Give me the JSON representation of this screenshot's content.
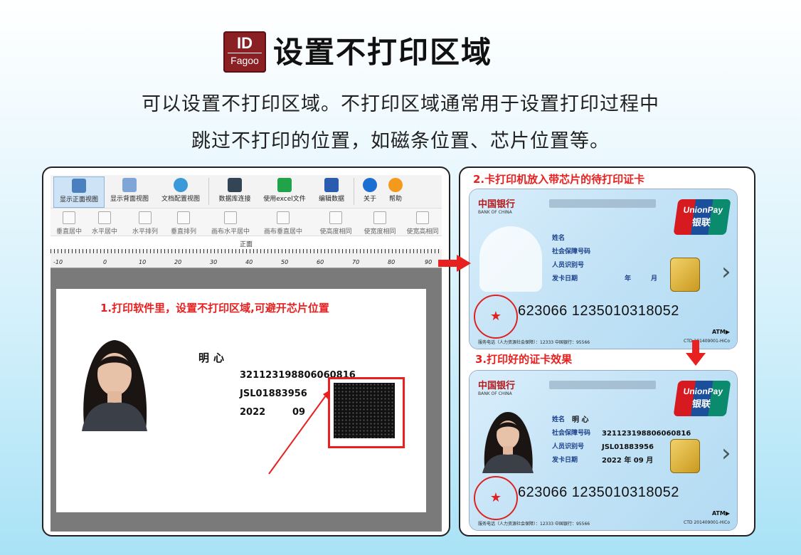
{
  "logo": {
    "line1": "ID",
    "line2": "Fagoo"
  },
  "title": "设置不打印区域",
  "subtitle": {
    "line1": "可以设置不打印区域。不打印区域通常用于设置打印过程中",
    "line2": "跳过不打印的位置，如磁条位置、芯片位置等。"
  },
  "software": {
    "toolbar1": [
      "显示正面视图",
      "显示背面视图",
      "文档配置视图",
      "数据库连接",
      "使用excel文件",
      "编辑数据",
      "关于",
      "帮助"
    ],
    "toolbar2": [
      "垂直居中",
      "水平居中",
      "水平排列",
      "垂直排列",
      "画布水平居中",
      "画布垂直居中",
      "使高度相同",
      "使宽度相同",
      "使宽高相同"
    ],
    "ruler_label": "正面",
    "ruler_numbers": [
      "-10",
      "0",
      "10",
      "20",
      "30",
      "40",
      "50",
      "60",
      "70",
      "80",
      "90"
    ],
    "instruction": "1.打印软件里，设置不打印区域,可避开芯片位置",
    "card": {
      "name": "明心",
      "id_number": "321123198806060816",
      "person_id": "JSL01883956",
      "year": "2022",
      "month": "09"
    }
  },
  "right": {
    "instruction2": "2.卡打印机放入带芯片的待打印证卡",
    "instruction3": "3.打印好的证卡效果",
    "bank": {
      "name": "中国银行",
      "english": "BANK OF CHINA"
    },
    "unionpay": {
      "en": "UnionPay",
      "cn": "银联"
    },
    "labels": [
      "姓名",
      "社会保障号码",
      "人员识别号",
      "发卡日期"
    ],
    "date_units": {
      "year": "年",
      "month": "月"
    },
    "card_number": "623066 1235010318052",
    "atm": "ATM▶",
    "footer": "服务电话（人力资源社会保障）：12333   中国银行：95566",
    "ctd": "CTD 201409001-HiCo",
    "seal": "★",
    "printed": {
      "name": "明 心",
      "id_number": "321123198806060816",
      "person_id": "JSL01883956",
      "date": "2022  年  09  月"
    }
  },
  "colors": {
    "accent_red": "#e8201f",
    "logo_bg": "#8a1f24",
    "label_blue": "#1b3f8b"
  }
}
